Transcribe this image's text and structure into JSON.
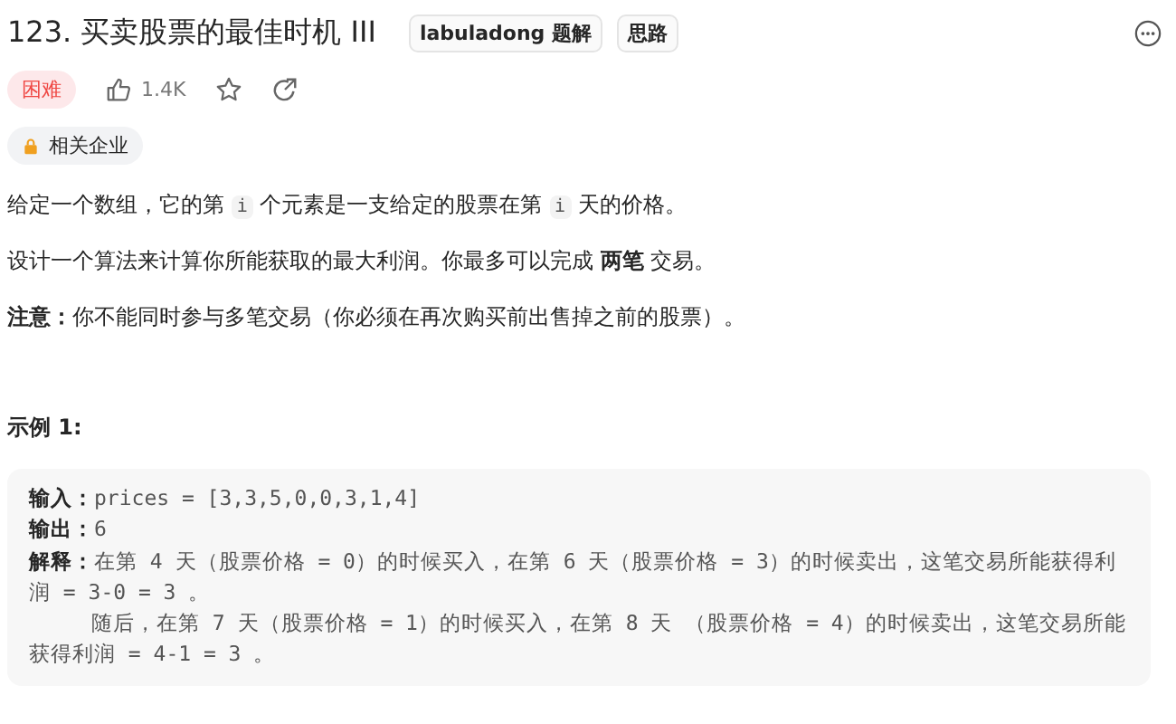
{
  "title": "123. 买卖股票的最佳时机 III",
  "tags": [
    "labuladong 题解",
    "思路"
  ],
  "difficulty": "困难",
  "likes": "1.4K",
  "companies": "相关企业",
  "paragraphs": [
    [
      {
        "kind": "text",
        "text": "给定一个数组，它的第 "
      },
      {
        "kind": "code",
        "text": "i"
      },
      {
        "kind": "text",
        "text": " 个元素是一支给定的股票在第 "
      },
      {
        "kind": "code",
        "text": "i"
      },
      {
        "kind": "text",
        "text": " 天的价格。"
      }
    ],
    [
      {
        "kind": "text",
        "text": "设计一个算法来计算你所能获取的最大利润。你最多可以完成 **两笔** 交易。"
      }
    ],
    [
      {
        "kind": "text",
        "text": "**注意：**你不能同时参与多笔交易（你必须在再次购买前出售掉之前的股票）。"
      }
    ]
  ],
  "example": {
    "heading": "示例 1:",
    "lines": [
      {
        "kind": "entry",
        "label": "输入：",
        "text": "prices = [3,3,5,0,0,3,1,4]"
      },
      {
        "kind": "entry",
        "label": "输出：",
        "text": "6"
      },
      {
        "kind": "entry",
        "label": "解释：",
        "text": "在第 4 天（股票价格 = 0）的时候买入，在第 6 天（股票价格 = 3）的时候卖出，这笔交易所能获得利润 = 3-0 = 3 。"
      },
      {
        "kind": "continuation",
        "text": "随后，在第 7 天（股票价格 = 1）的时候买入，在第 8 天 （股票价格 = 4）的时候卖出，这笔交易所能获得利润 = 4-1 = 3 。"
      }
    ]
  }
}
